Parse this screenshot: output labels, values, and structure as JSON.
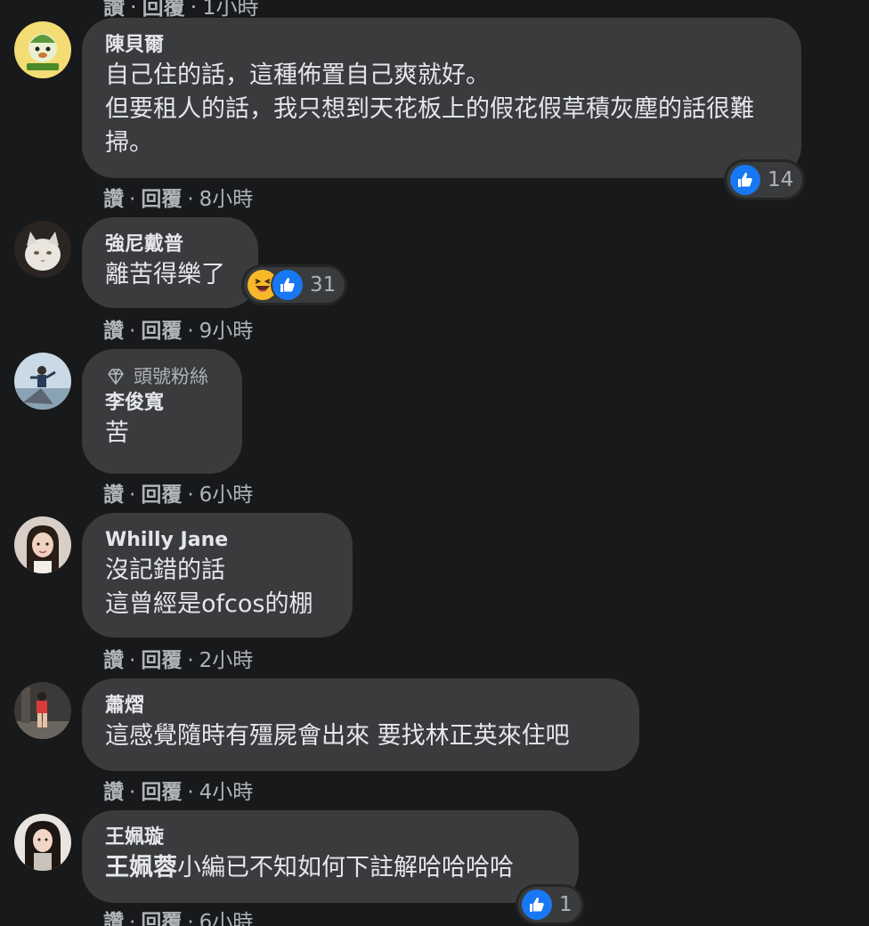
{
  "top_actions": {
    "like": "讚",
    "reply": "回覆",
    "time": "1小時"
  },
  "comments": [
    {
      "author": "陳貝爾",
      "text": "自己住的話，這種佈置自己爽就好。\n但要租人的話，我只想到天花板上的假花假草積灰塵的話很難掃。",
      "reaction_count": "14",
      "like": "讚",
      "reply": "回覆",
      "time": "8小時"
    },
    {
      "author": "強尼戴普",
      "text": "離苦得樂了",
      "reaction_count": "31",
      "like": "讚",
      "reply": "回覆",
      "time": "9小時"
    },
    {
      "badge": "頭號粉絲",
      "author": "李俊寬",
      "text": "苦",
      "like": "讚",
      "reply": "回覆",
      "time": "6小時"
    },
    {
      "author": "Whilly Jane",
      "text": "沒記錯的話\n這曾經是ofcos的棚",
      "like": "讚",
      "reply": "回覆",
      "time": "2小時"
    },
    {
      "author": "蕭熠",
      "text": "這感覺隨時有殭屍會出來 要找林正英來住吧",
      "like": "讚",
      "reply": "回覆",
      "time": "4小時"
    },
    {
      "author": "王姵璇",
      "mention": "王姵蓉",
      "text": "小編已不知如何下註解哈哈哈哈",
      "reaction_count": "1",
      "like": "讚",
      "reply": "回覆",
      "time": "6小時"
    }
  ],
  "icons": {
    "like": "thumbs-up-icon",
    "haha": "laughing-face-icon",
    "badge": "diamond-icon"
  },
  "colors": {
    "background": "#18191a",
    "bubble": "#3a3b3c",
    "primary_text": "#e4e6eb",
    "secondary_text": "#b0b3b8",
    "like_blue": "#1877f2",
    "haha_yellow": "#f7b928"
  }
}
